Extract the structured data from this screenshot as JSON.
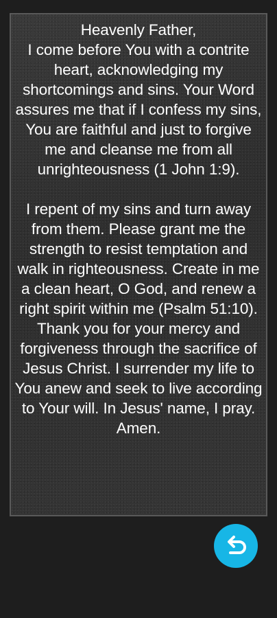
{
  "prayer": {
    "text": "Heavenly Father,\nI come before You with a contrite heart, acknowledging my shortcomings and sins. Your Word assures me that if I confess my sins, You are faithful and just to forgive me and cleanse me from all unrighteousness (1 John 1:9).\n\nI repent of my sins and turn away from them. Please grant me the strength to resist temptation and walk in righteousness. Create in me a clean heart, O God, and renew a right spirit within me (Psalm 51:10).\nThank you for your mercy and forgiveness through the sacrifice of Jesus Christ. I surrender my life to You anew and seek to live according to Your will. In Jesus' name, I pray. Amen."
  },
  "back_button": {
    "icon": "return-arrow-icon",
    "color": "#17b6e6"
  },
  "colors": {
    "background": "#1e1e1e",
    "card": "#333333",
    "card_border": "#5a5a5a",
    "text": "#ffffff"
  }
}
